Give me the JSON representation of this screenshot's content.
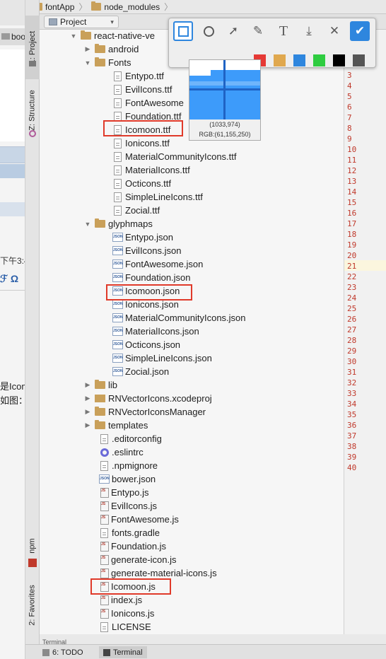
{
  "breadcrumb": [
    "fontApp",
    "node_modules"
  ],
  "toolbar": {
    "view_selector": "Project"
  },
  "left_tabs": {
    "project": "1: Project",
    "structure": "Z: Structure",
    "npm": "npm",
    "favorites": "2: Favorites"
  },
  "left_peek": {
    "tab_label": "boo",
    "time_text": "下午3:4",
    "omega": "Ω",
    "text1": "是Icom",
    "text2": "如图："
  },
  "tree": {
    "root": "react-native-ve",
    "android": "android",
    "fonts_folder": "Fonts",
    "fonts": [
      "Entypo.ttf",
      "EvilIcons.ttf",
      "FontAwesome",
      "Foundation.ttf",
      "Icomoon.ttf",
      "Ionicons.ttf",
      "MaterialCommunityIcons.ttf",
      "MaterialIcons.ttf",
      "Octicons.ttf",
      "SimpleLineIcons.ttf",
      "Zocial.ttf"
    ],
    "glyphmaps_folder": "glyphmaps",
    "glyphmaps": [
      "Entypo.json",
      "EvilIcons.json",
      "FontAwesome.json",
      "Foundation.json",
      "Icomoon.json",
      "Ionicons.json",
      "MaterialCommunityIcons.json",
      "MaterialIcons.json",
      "Octicons.json",
      "SimpleLineIcons.json",
      "Zocial.json"
    ],
    "lib": "lib",
    "xcodeproj": "RNVectorIcons.xcodeproj",
    "manager": "RNVectorIconsManager",
    "templates": "templates",
    "editorconfig": ".editorconfig",
    "eslintrc": ".eslintrc",
    "npmignore": ".npmignore",
    "bower": "bower.json",
    "js_files": [
      "Entypo.js",
      "EvilIcons.js",
      "FontAwesome.js"
    ],
    "fonts_gradle": "fonts.gradle",
    "foundation_js": "Foundation.js",
    "gen_icon": "generate-icon.js",
    "gen_material": "generate-material-icons.js",
    "icomoon_js": "Icomoon.js",
    "index_js": "index.js",
    "ionicons_js": "Ionicons.js",
    "license": "LICENSE"
  },
  "line_numbers": [
    "3",
    "4",
    "5",
    "6",
    "7",
    "8",
    "9",
    "10",
    "11",
    "12",
    "13",
    "14",
    "15",
    "16",
    "17",
    "18",
    "19",
    "20",
    "21",
    "22",
    "23",
    "24",
    "25",
    "26",
    "27",
    "28",
    "29",
    "30",
    "31",
    "32",
    "33",
    "34",
    "35",
    "36",
    "37",
    "38",
    "39",
    "40"
  ],
  "magnifier": {
    "coords": "(1033,974)",
    "rgb": "RGB:(61,155,250)"
  },
  "snip_colors": [
    "#e53935",
    "#e0a84e",
    "#2e86de",
    "#2ecc40",
    "#000000",
    "#555555"
  ],
  "snip_tools": {
    "text_glyph": "T",
    "close_glyph": "✕",
    "confirm_glyph": "✔"
  },
  "bottom": {
    "todo": "6: TODO",
    "terminal": "Terminal",
    "terminal_tab": "Terminal"
  },
  "colors": {
    "highlight": "#e03a2a",
    "accent_blue": "#2e86de"
  }
}
